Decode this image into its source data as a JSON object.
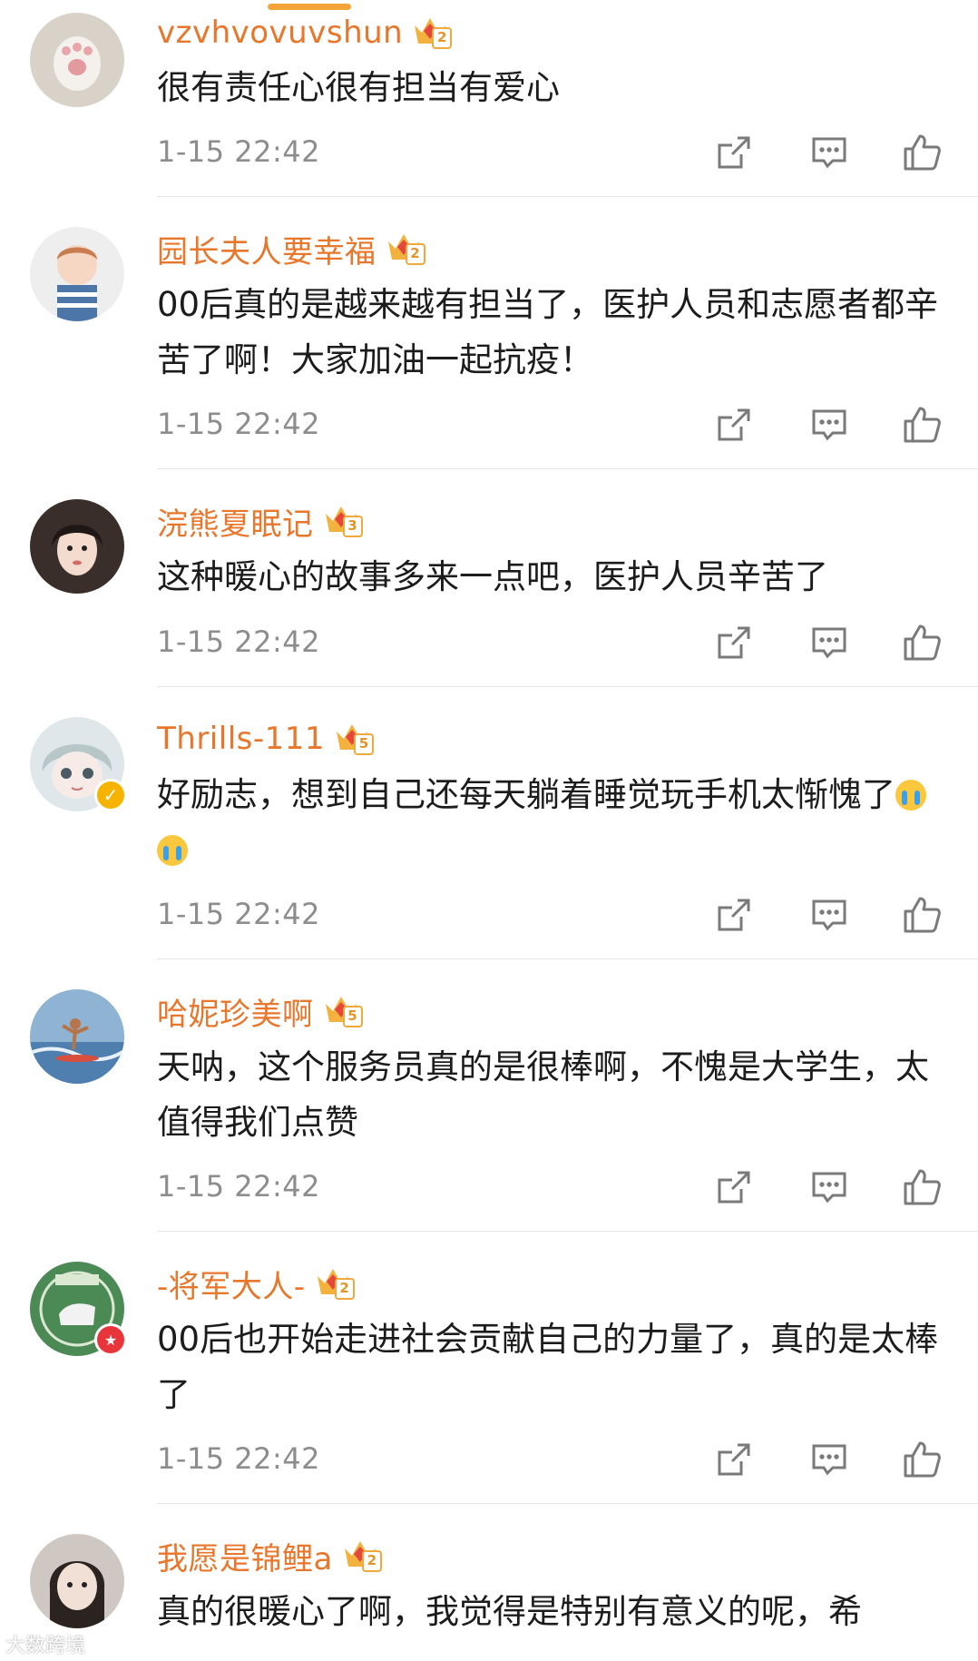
{
  "comments": [
    {
      "username": "vzvhvovuvshun",
      "level": "2",
      "text": "很有责任心很有担当有爱心",
      "time": "1-15 22:42"
    },
    {
      "username": "园长夫人要幸福",
      "level": "2",
      "text": "00后真的是越来越有担当了，医护人员和志愿者都辛苦了啊！大家加油一起抗疫！",
      "time": "1-15 22:42"
    },
    {
      "username": "浣熊夏眠记",
      "level": "3",
      "text": "这种暖心的故事多来一点吧，医护人员辛苦了",
      "time": "1-15 22:42"
    },
    {
      "username": "Thrills-111",
      "level": "5",
      "text": "好励志，想到自己还每天躺着睡觉玩手机太惭愧了",
      "time": "1-15 22:42"
    },
    {
      "username": "哈妮珍美啊",
      "level": "5",
      "text": "天呐，这个服务员真的是很棒啊，不愧是大学生，太值得我们点赞",
      "time": "1-15 22:42"
    },
    {
      "username": "-将军大人-",
      "level": "2",
      "text": "00后也开始走进社会贡献自己的力量了，真的是太棒了",
      "time": "1-15 22:42"
    },
    {
      "username": "我愿是锦鲤a",
      "level": "2",
      "text": "真的很暖心了啊，我觉得是特别有意义的呢，希",
      "time": ""
    }
  ],
  "icons": {
    "share": "share-icon",
    "reply": "comment-icon",
    "like": "thumbs-up-icon",
    "crown": "vip-crown-icon"
  },
  "colors": {
    "username": "#e8762b",
    "time": "#8d8d8d",
    "text": "#1c1c1c",
    "accent": "#f3a53a"
  },
  "watermark": "大数跨境"
}
